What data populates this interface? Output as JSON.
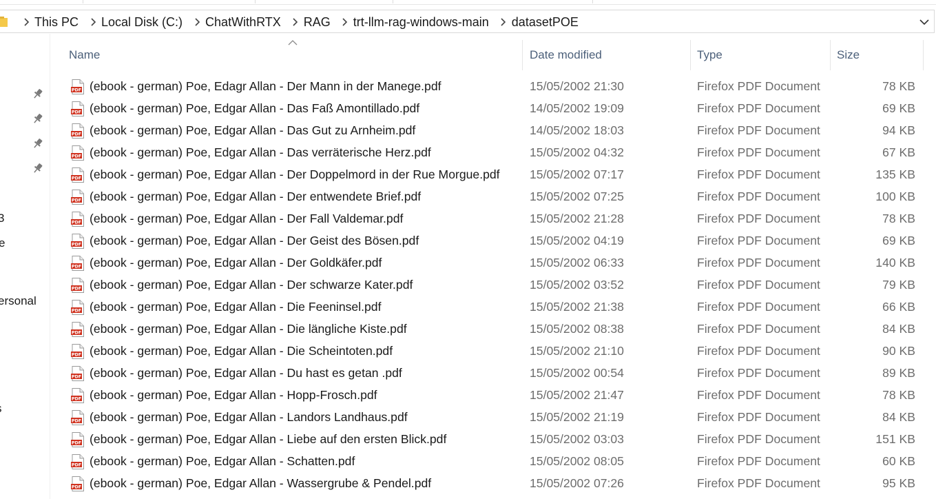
{
  "breadcrumb": [
    "This PC",
    "Local Disk (C:)",
    "ChatWithRTX",
    "RAG",
    "trt-llm-rag-windows-main",
    "datasetPOE"
  ],
  "nav": {
    "items_cut": [
      "3",
      "e",
      "ersonal",
      "s"
    ]
  },
  "columns": {
    "name": "Name",
    "date": "Date modified",
    "type": "Type",
    "size": "Size"
  },
  "files": [
    {
      "name": "(ebook - german) Poe, Edagr Allan - Der Mann in der Manege.pdf",
      "date": "15/05/2002 21:30",
      "type": "Firefox PDF Document",
      "size": "78 KB"
    },
    {
      "name": "(ebook - german) Poe, Edgar Allan - Das Faß Amontillado.pdf",
      "date": "14/05/2002 19:09",
      "type": "Firefox PDF Document",
      "size": "69 KB"
    },
    {
      "name": "(ebook - german) Poe, Edgar Allan - Das Gut zu Arnheim.pdf",
      "date": "14/05/2002 18:03",
      "type": "Firefox PDF Document",
      "size": "94 KB"
    },
    {
      "name": "(ebook - german) Poe, Edgar Allan - Das verräterische Herz.pdf",
      "date": "15/05/2002 04:32",
      "type": "Firefox PDF Document",
      "size": "67 KB"
    },
    {
      "name": "(ebook - german) Poe, Edgar Allan - Der Doppelmord in der Rue Morgue.pdf",
      "date": "15/05/2002 07:17",
      "type": "Firefox PDF Document",
      "size": "135 KB"
    },
    {
      "name": "(ebook - german) Poe, Edgar Allan - Der entwendete Brief.pdf",
      "date": "15/05/2002 07:25",
      "type": "Firefox PDF Document",
      "size": "100 KB"
    },
    {
      "name": "(ebook - german) Poe, Edgar Allan - Der Fall Valdemar.pdf",
      "date": "15/05/2002 21:28",
      "type": "Firefox PDF Document",
      "size": "78 KB"
    },
    {
      "name": "(ebook - german) Poe, Edgar Allan - Der Geist des Bösen.pdf",
      "date": "15/05/2002 04:19",
      "type": "Firefox PDF Document",
      "size": "69 KB"
    },
    {
      "name": "(ebook - german) Poe, Edgar Allan - Der Goldkäfer.pdf",
      "date": "15/05/2002 06:33",
      "type": "Firefox PDF Document",
      "size": "140 KB"
    },
    {
      "name": "(ebook - german) Poe, Edgar Allan - Der schwarze Kater.pdf",
      "date": "15/05/2002 03:52",
      "type": "Firefox PDF Document",
      "size": "79 KB"
    },
    {
      "name": "(ebook - german) Poe, Edgar Allan - Die Feeninsel.pdf",
      "date": "15/05/2002 21:38",
      "type": "Firefox PDF Document",
      "size": "66 KB"
    },
    {
      "name": "(ebook - german) Poe, Edgar Allan - Die längliche Kiste.pdf",
      "date": "15/05/2002 08:38",
      "type": "Firefox PDF Document",
      "size": "84 KB"
    },
    {
      "name": "(ebook - german) Poe, Edgar Allan - Die Scheintoten.pdf",
      "date": "15/05/2002 21:10",
      "type": "Firefox PDF Document",
      "size": "90 KB"
    },
    {
      "name": "(ebook - german) Poe, Edgar Allan - Du hast es getan .pdf",
      "date": "15/05/2002 00:54",
      "type": "Firefox PDF Document",
      "size": "89 KB"
    },
    {
      "name": "(ebook - german) Poe, Edgar Allan - Hopp-Frosch.pdf",
      "date": "15/05/2002 21:47",
      "type": "Firefox PDF Document",
      "size": "78 KB"
    },
    {
      "name": "(ebook - german) Poe, Edgar Allan - Landors Landhaus.pdf",
      "date": "15/05/2002 21:19",
      "type": "Firefox PDF Document",
      "size": "84 KB"
    },
    {
      "name": "(ebook - german) Poe, Edgar Allan - Liebe auf den ersten Blick.pdf",
      "date": "15/05/2002 03:03",
      "type": "Firefox PDF Document",
      "size": "151 KB"
    },
    {
      "name": "(ebook - german) Poe, Edgar Allan - Schatten.pdf",
      "date": "15/05/2002 08:05",
      "type": "Firefox PDF Document",
      "size": "60 KB"
    },
    {
      "name": "(ebook - german) Poe, Edgar Allan - Wassergrube & Pendel.pdf",
      "date": "15/05/2002 07:26",
      "type": "Firefox PDF Document",
      "size": "95 KB"
    }
  ],
  "icons": {
    "file": "pdf-file-icon",
    "pin": "pin-icon",
    "folder": "folder-icon",
    "separator": "chevron-right-icon",
    "dropdown": "chevron-down-icon",
    "sort": "sort-ascending-icon"
  },
  "colors": {
    "pdf_red": "#d0311e",
    "header_text": "#4c607a",
    "secondary_text": "#6d6d6d",
    "folder_yellow": "#f5c94a"
  }
}
